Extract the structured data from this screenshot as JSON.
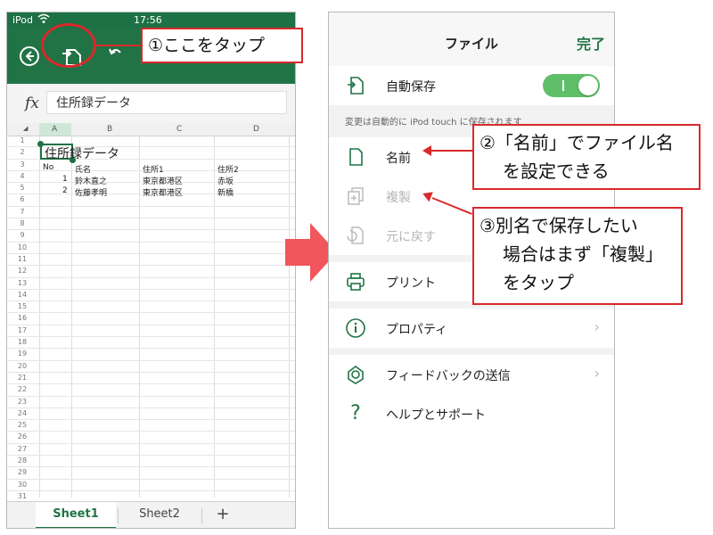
{
  "excel": {
    "status": {
      "carrier": "iPod",
      "time": "17:56"
    },
    "formula": {
      "fx": "fx",
      "text": "住所録データ"
    },
    "columns": [
      "A",
      "B",
      "C",
      "D"
    ],
    "row_numbers": [
      "1",
      "2",
      "3",
      "4",
      "5",
      "6",
      "7",
      "8",
      "9",
      "10",
      "11",
      "12",
      "13",
      "14",
      "15",
      "16",
      "17",
      "18",
      "19",
      "20",
      "21",
      "22",
      "23",
      "24",
      "25",
      "26",
      "27",
      "28",
      "29",
      "30",
      "31"
    ],
    "cells": {
      "title": "住所録データ",
      "h_no": "No",
      "h_name": "氏名",
      "h_addr1": "住所1",
      "h_addr2": "住所2",
      "r1_no": "1",
      "r1_name": "鈴木直之",
      "r1_addr1": "東京都港区",
      "r1_addr2": "赤坂",
      "r2_no": "2",
      "r2_name": "佐藤孝明",
      "r2_addr1": "東京都港区",
      "r2_addr2": "新橋"
    },
    "tabs": {
      "sheet1": "Sheet1",
      "sheet2": "Sheet2",
      "add": "+"
    }
  },
  "file_menu": {
    "title": "ファイル",
    "done": "完了",
    "autosave_label": "自動保存",
    "autosave_on": true,
    "autosave_note": "変更は自動的に iPod touch に保存されます",
    "items": {
      "name": "名前",
      "duplicate": "複製",
      "revert": "元に戻す",
      "print": "プリント",
      "properties": "プロパティ",
      "feedback": "フィードバックの送信",
      "help": "ヘルプとサポート"
    }
  },
  "callouts": {
    "c1": "①ここをタップ",
    "c2_line1": "②「名前」でファイル名",
    "c2_line2": "を設定できる",
    "c3_line1": "③別名で保存したい",
    "c3_line2": "場合はまず「複製」",
    "c3_line3": "をタップ"
  },
  "colors": {
    "excel_green": "#217346",
    "callout_red": "#d9292c",
    "arrow_pink": "#f0565c",
    "toggle_green": "#5fbf68"
  }
}
